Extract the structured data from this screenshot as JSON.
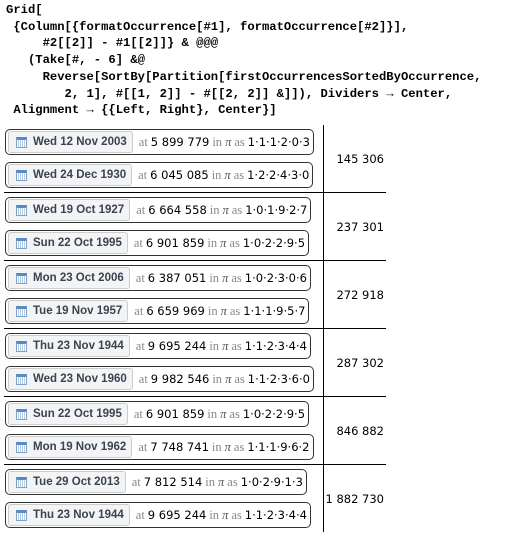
{
  "input_code": "Grid[\n {Column[{formatOccurrence[#1], formatOccurrence[#2]}],\n     #2[[2]] - #1[[2]]} & @@@\n   (Take[#, - 6] &@\n     Reverse[SortBy[Partition[firstOccurrencesSortedByOccurrence,\n        2, 1], #[[1, 2]] - #[[2, 2]] &]]), Dividers → Center,\n Alignment → {{Left, Right}, Center}]",
  "labels": {
    "at": "at",
    "in": "in",
    "pi": "π",
    "as": "as"
  },
  "icon": "calendar-icon",
  "rows": [
    {
      "items": [
        {
          "date": "Wed 12 Nov 2003",
          "position": "5 899 779",
          "digits": "1·1·1·2·0·3"
        },
        {
          "date": "Wed 24 Dec 1930",
          "position": "6 045 085",
          "digits": "1·2·2·4·3·0"
        }
      ],
      "gap": "145 306"
    },
    {
      "items": [
        {
          "date": "Wed 19 Oct 1927",
          "position": "6 664 558",
          "digits": "1·0·1·9·2·7"
        },
        {
          "date": "Sun 22 Oct 1995",
          "position": "6 901 859",
          "digits": "1·0·2·2·9·5"
        }
      ],
      "gap": "237 301"
    },
    {
      "items": [
        {
          "date": "Mon 23 Oct 2006",
          "position": "6 387 051",
          "digits": "1·0·2·3·0·6"
        },
        {
          "date": "Tue 19 Nov 1957",
          "position": "6 659 969",
          "digits": "1·1·1·9·5·7"
        }
      ],
      "gap": "272 918"
    },
    {
      "items": [
        {
          "date": "Thu 23 Nov 1944",
          "position": "9 695 244",
          "digits": "1·1·2·3·4·4"
        },
        {
          "date": "Wed 23 Nov 1960",
          "position": "9 982 546",
          "digits": "1·1·2·3·6·0"
        }
      ],
      "gap": "287 302"
    },
    {
      "items": [
        {
          "date": "Sun 22 Oct 1995",
          "position": "6 901 859",
          "digits": "1·0·2·2·9·5"
        },
        {
          "date": "Mon 19 Nov 1962",
          "position": "7 748 741",
          "digits": "1·1·1·9·6·2"
        }
      ],
      "gap": "846 882"
    },
    {
      "items": [
        {
          "date": "Tue 29 Oct 2013",
          "position": "7 812 514",
          "digits": "1·0·2·9·1·3"
        },
        {
          "date": "Thu 23 Nov 1944",
          "position": "9 695 244",
          "digits": "1·1·2·3·4·4"
        }
      ],
      "gap": "1 882 730"
    }
  ]
}
